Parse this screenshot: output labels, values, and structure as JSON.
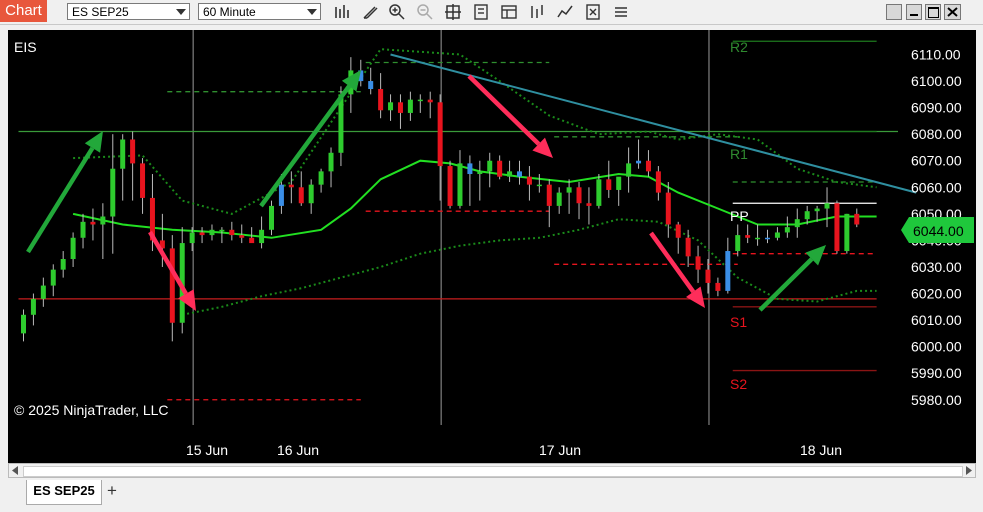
{
  "window": {
    "title_tab": "Chart",
    "instrument": "ES SEP25",
    "interval": "60 Minute",
    "toolbar_icons": [
      "bar-chart-icon",
      "pencil-icon",
      "zoom-in-icon",
      "zoom-out-icon",
      "crosshair-icon",
      "template-icon",
      "data-box-icon",
      "strategy-icon",
      "indicator-icon",
      "properties-icon",
      "more-icon"
    ],
    "window_buttons": [
      "restore-icon",
      "minimize-icon",
      "maximize-icon",
      "close-icon"
    ]
  },
  "chart": {
    "instrument_label": "EIS",
    "copyright": "© 2025 NinjaTrader, LLC",
    "last_price": "6044.00",
    "pivot_labels": {
      "r2": "R2",
      "r1": "R1",
      "pp": "PP",
      "s1": "S1",
      "s2": "S2"
    },
    "colors": {
      "bg": "#000000",
      "up": "#2ecc2e",
      "down": "#e8141e",
      "neutral": "#3a8ee6",
      "ma": "#22e022",
      "bollinger": "#1a8a1a",
      "trend": "#2f8fa0",
      "arrow_up": "#22a83a",
      "arrow_down": "#ff2d5a",
      "price_tag": "#1fc83c"
    }
  },
  "chart_data": {
    "type": "candlestick",
    "title": "EIS",
    "x_tick_labels": [
      "15 Jun",
      "16 Jun",
      "17 Jun",
      "18 Jun"
    ],
    "y_tick_labels": [
      "6110.00",
      "6100.00",
      "6090.00",
      "6080.00",
      "6070.00",
      "6060.00",
      "6050.00",
      "6040.00",
      "6030.00",
      "6020.00",
      "6010.00",
      "6000.00",
      "5990.00",
      "5980.00"
    ],
    "ylim": [
      5976,
      6114
    ],
    "candles": [
      [
        6005,
        6014,
        6002,
        6012
      ],
      [
        6012,
        6020,
        6008,
        6018
      ],
      [
        6018,
        6026,
        6015,
        6023
      ],
      [
        6023,
        6031,
        6019,
        6029
      ],
      [
        6029,
        6036,
        6026,
        6033
      ],
      [
        6033,
        6043,
        6030,
        6041
      ],
      [
        6041,
        6050,
        6037,
        6047
      ],
      [
        6047,
        6052,
        6040,
        6046
      ],
      [
        6046,
        6054,
        6033,
        6049
      ],
      [
        6049,
        6080,
        6035,
        6067
      ],
      [
        6067,
        6080,
        6055,
        6078
      ],
      [
        6078,
        6081,
        6055,
        6069
      ],
      [
        6069,
        6071,
        6050,
        6056
      ],
      [
        6056,
        6065,
        6036,
        6040
      ],
      [
        6040,
        6050,
        6030,
        6037
      ],
      [
        6037,
        6042,
        6002,
        6009
      ],
      [
        6009,
        6045,
        6005,
        6039
      ],
      [
        6039,
        6045,
        6036,
        6043
      ],
      [
        6043,
        6045,
        6039,
        6042
      ],
      [
        6042,
        6046,
        6040,
        6044
      ],
      [
        6044,
        6045,
        6039,
        6044
      ],
      [
        6044,
        6047,
        6040,
        6042
      ],
      [
        6042,
        6046,
        6039,
        6041
      ],
      [
        6041,
        6045,
        6040,
        6039
      ],
      [
        6039,
        6049,
        6037,
        6044
      ],
      [
        6044,
        6055,
        6042,
        6053
      ],
      [
        6053,
        6065,
        6050,
        6061
      ],
      [
        6061,
        6066,
        6054,
        6060
      ],
      [
        6060,
        6066,
        6053,
        6054
      ],
      [
        6054,
        6063,
        6050,
        6061
      ],
      [
        6061,
        6067,
        6058,
        6066
      ],
      [
        6066,
        6075,
        6060,
        6073
      ],
      [
        6073,
        6098,
        6068,
        6095
      ],
      [
        6095,
        6109,
        6088,
        6104
      ],
      [
        6104,
        6108,
        6098,
        6100
      ],
      [
        6100,
        6105,
        6095,
        6097
      ],
      [
        6097,
        6103,
        6086,
        6089
      ],
      [
        6089,
        6095,
        6085,
        6092
      ],
      [
        6092,
        6095,
        6082,
        6088
      ],
      [
        6088,
        6096,
        6085,
        6093
      ],
      [
        6093,
        6095,
        6088,
        6093
      ],
      [
        6093,
        6096,
        6086,
        6092
      ],
      [
        6092,
        6095,
        6055,
        6068
      ],
      [
        6068,
        6070,
        6052,
        6053
      ],
      [
        6053,
        6074,
        6052,
        6069
      ],
      [
        6069,
        6072,
        6053,
        6065
      ],
      [
        6065,
        6070,
        6055,
        6066
      ],
      [
        6066,
        6073,
        6060,
        6070
      ],
      [
        6070,
        6072,
        6063,
        6064
      ],
      [
        6064,
        6070,
        6062,
        6066
      ],
      [
        6066,
        6070,
        6061,
        6064
      ],
      [
        6064,
        6068,
        6055,
        6061
      ],
      [
        6061,
        6065,
        6058,
        6061
      ],
      [
        6061,
        6063,
        6045,
        6053
      ],
      [
        6053,
        6060,
        6050,
        6058
      ],
      [
        6058,
        6063,
        6050,
        6060
      ],
      [
        6060,
        6062,
        6048,
        6054
      ],
      [
        6054,
        6060,
        6046,
        6053
      ],
      [
        6053,
        6065,
        6052,
        6063
      ],
      [
        6063,
        6070,
        6056,
        6059
      ],
      [
        6059,
        6062,
        6053,
        6064
      ],
      [
        6064,
        6075,
        6058,
        6069
      ],
      [
        6069,
        6078,
        6067,
        6070
      ],
      [
        6070,
        6074,
        6064,
        6066
      ],
      [
        6066,
        6068,
        6055,
        6058
      ],
      [
        6058,
        6062,
        6041,
        6046
      ],
      [
        6046,
        6047,
        6035,
        6041
      ],
      [
        6041,
        6044,
        6030,
        6034
      ],
      [
        6034,
        6038,
        6024,
        6029
      ],
      [
        6029,
        6033,
        6020,
        6024
      ],
      [
        6024,
        6026,
        6019,
        6021
      ],
      [
        6021,
        6041,
        6020,
        6036
      ],
      [
        6036,
        6046,
        6034,
        6042
      ],
      [
        6042,
        6046,
        6039,
        6041
      ],
      [
        6041,
        6046,
        6038,
        6041
      ],
      [
        6041,
        6044,
        6039,
        6041
      ],
      [
        6041,
        6045,
        6040,
        6043
      ],
      [
        6043,
        6049,
        6041,
        6045
      ],
      [
        6045,
        6052,
        6041,
        6048
      ],
      [
        6048,
        6053,
        6046,
        6051
      ],
      [
        6051,
        6053,
        6047,
        6052
      ],
      [
        6052,
        6060,
        6045,
        6054
      ],
      [
        6054,
        6055,
        6035,
        6036
      ],
      [
        6036,
        6050,
        6035,
        6050
      ],
      [
        6050,
        6052,
        6045,
        6046
      ]
    ],
    "neutral_candles": [
      26,
      34,
      35,
      45,
      50,
      62,
      71,
      75
    ],
    "moving_average": [
      [
        5,
        6050
      ],
      [
        10,
        6046
      ],
      [
        15,
        6044
      ],
      [
        20,
        6043
      ],
      [
        25,
        6041
      ],
      [
        30,
        6044
      ],
      [
        33,
        6052
      ],
      [
        36,
        6063
      ],
      [
        40,
        6070
      ],
      [
        43,
        6069
      ],
      [
        46,
        6066
      ],
      [
        50,
        6064
      ],
      [
        55,
        6062
      ],
      [
        60,
        6065
      ],
      [
        63,
        6064
      ],
      [
        66,
        6058
      ],
      [
        70,
        6052
      ],
      [
        74,
        6046
      ],
      [
        78,
        6046
      ],
      [
        82,
        6049
      ],
      [
        86,
        6049
      ]
    ],
    "bollinger_upper": [
      [
        5,
        6071
      ],
      [
        12,
        6072
      ],
      [
        16,
        6055
      ],
      [
        21,
        6050
      ],
      [
        27,
        6062
      ],
      [
        32,
        6090
      ],
      [
        36,
        6112
      ],
      [
        40,
        6111
      ],
      [
        44,
        6110
      ],
      [
        48,
        6100
      ],
      [
        53,
        6087
      ],
      [
        58,
        6080
      ],
      [
        63,
        6081
      ],
      [
        66,
        6078
      ],
      [
        70,
        6080
      ],
      [
        74,
        6078
      ],
      [
        78,
        6067
      ],
      [
        82,
        6062
      ],
      [
        86,
        6060
      ]
    ],
    "bollinger_lower": [
      [
        16,
        6012
      ],
      [
        20,
        6015
      ],
      [
        24,
        6019
      ],
      [
        28,
        6022
      ],
      [
        32,
        6026
      ],
      [
        36,
        6030
      ],
      [
        40,
        6035
      ],
      [
        44,
        6038
      ],
      [
        48,
        6040
      ],
      [
        52,
        6041
      ],
      [
        56,
        6044
      ],
      [
        60,
        6048
      ],
      [
        64,
        6047
      ],
      [
        68,
        6040
      ],
      [
        72,
        6026
      ],
      [
        76,
        6018
      ],
      [
        80,
        6017
      ],
      [
        84,
        6021
      ],
      [
        86,
        6021
      ]
    ],
    "trend_line": [
      [
        37,
        6110
      ],
      [
        90,
        6058
      ]
    ],
    "horizontal_lines": [
      {
        "y": 6081,
        "x0": 0,
        "x1": 90,
        "style": "solid",
        "color": "#3a9a3a"
      },
      {
        "y": 6018,
        "x0": 0,
        "x1": 86,
        "style": "solid",
        "color": "#c81e1e"
      },
      {
        "y": 6096,
        "x0": 15,
        "x1": 34,
        "style": "dashed",
        "color": "#2f8f2f"
      },
      {
        "y": 6107,
        "x0": 35,
        "x1": 53,
        "style": "dashed",
        "color": "#2f8f2f"
      },
      {
        "y": 6051,
        "x0": 35,
        "x1": 53,
        "style": "dashed",
        "color": "#e8141e"
      },
      {
        "y": 6031,
        "x0": 54,
        "x1": 72,
        "style": "dashed",
        "color": "#e8141e"
      },
      {
        "y": 6079,
        "x0": 54,
        "x1": 72,
        "style": "dashed",
        "color": "#2f8f2f"
      },
      {
        "y": 5980,
        "x0": 15,
        "x1": 34,
        "style": "dashed",
        "color": "#e8141e"
      },
      {
        "y": 6062,
        "x0": 72,
        "x1": 86,
        "style": "dashed",
        "color": "#2f8f2f"
      },
      {
        "y": 6035,
        "x0": 72,
        "x1": 86,
        "style": "dashed",
        "color": "#e8141e"
      },
      {
        "y": 6054,
        "x0": 72,
        "x1": 86,
        "style": "solid",
        "color": "#ffffff"
      },
      {
        "y": 6115,
        "x0": 72,
        "x1": 86,
        "style": "solid",
        "color": "#1e7a1e"
      },
      {
        "y": 6081,
        "x0": 72,
        "x1": 86,
        "style": "solid",
        "color": "#1e7a1e"
      },
      {
        "y": 6015,
        "x0": 72,
        "x1": 86,
        "style": "solid",
        "color": "#8a1414"
      },
      {
        "y": 5991,
        "x0": 72,
        "x1": 86,
        "style": "solid",
        "color": "#8a1414"
      }
    ],
    "session_breaks": [
      17,
      42,
      69
    ],
    "pivot_levels": {
      "R2": 6115,
      "R1": 6081,
      "PP": 6054,
      "S1": 6015,
      "S2": 5991
    }
  }
}
